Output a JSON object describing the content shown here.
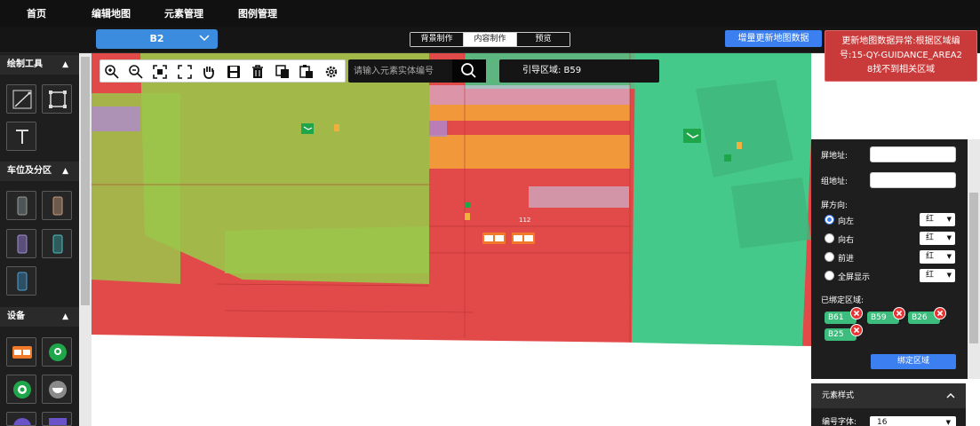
{
  "nav": {
    "items": [
      "首页",
      "编辑地图",
      "元素管理",
      "图例管理"
    ]
  },
  "floor_select": {
    "value": "B2"
  },
  "mode_tabs": {
    "items": [
      "背景制作",
      "内容制作",
      "预览"
    ],
    "active_index": 1
  },
  "update_button": {
    "label": "增量更新地图数据"
  },
  "error_toast": {
    "line1": "更新地图数据异常:根据区域编",
    "line2": "号:15-QY-GUIDANCE_AREA2",
    "line3": "8找不到相关区域"
  },
  "sidebar": {
    "sections": [
      {
        "title": "绘制工具",
        "tools": [
          "line-tool-icon",
          "rect-tool-icon",
          "text-tool-icon"
        ]
      },
      {
        "title": "车位及分区",
        "tools": [
          "parking-gray-icon",
          "parking-brown-icon",
          "parking-purple-icon",
          "parking-teal-icon",
          "parking-blue-icon"
        ]
      },
      {
        "title": "设备",
        "tools": [
          "screen-device-icon",
          "camera-device-icon",
          "green-camera-icon",
          "dome-camera-icon"
        ]
      }
    ]
  },
  "map_toolbar": {
    "icons": [
      "zoom-in-icon",
      "zoom-out-icon",
      "fit-icon",
      "fullscreen-icon",
      "pan-hand-icon",
      "save-icon",
      "delete-icon",
      "copy-icon",
      "paste-icon",
      "settings-icon"
    ]
  },
  "search": {
    "placeholder": "请输入元素实体编号"
  },
  "guide_area": {
    "label": "引导区域: B59"
  },
  "map": {
    "label_112": "112"
  },
  "right_panel": {
    "screen_addr_label": "屏地址:",
    "screen_addr_value": "",
    "group_addr_label": "组地址:",
    "group_addr_value": "",
    "direction_label": "屏方向:",
    "directions": [
      {
        "label": "向左",
        "color": "红",
        "selected": true
      },
      {
        "label": "向右",
        "color": "红",
        "selected": false
      },
      {
        "label": "前进",
        "color": "红",
        "selected": false
      },
      {
        "label": "全屏显示",
        "color": "红",
        "selected": false
      }
    ],
    "bound_label": "已绑定区域:",
    "bound_areas": [
      "B61",
      "B59",
      "B26",
      "B25"
    ],
    "bind_button": "绑定区域"
  },
  "element_style": {
    "title": "元素样式",
    "font_label": "编号字体:",
    "font_value": "16"
  },
  "colors": {
    "accent": "#3b7ff0",
    "zone_red": "#e24a4a",
    "zone_green": "#45c98a",
    "zone_olive": "#9bc54a",
    "zone_orange": "#f0983a",
    "toast": "#c93a3a"
  }
}
